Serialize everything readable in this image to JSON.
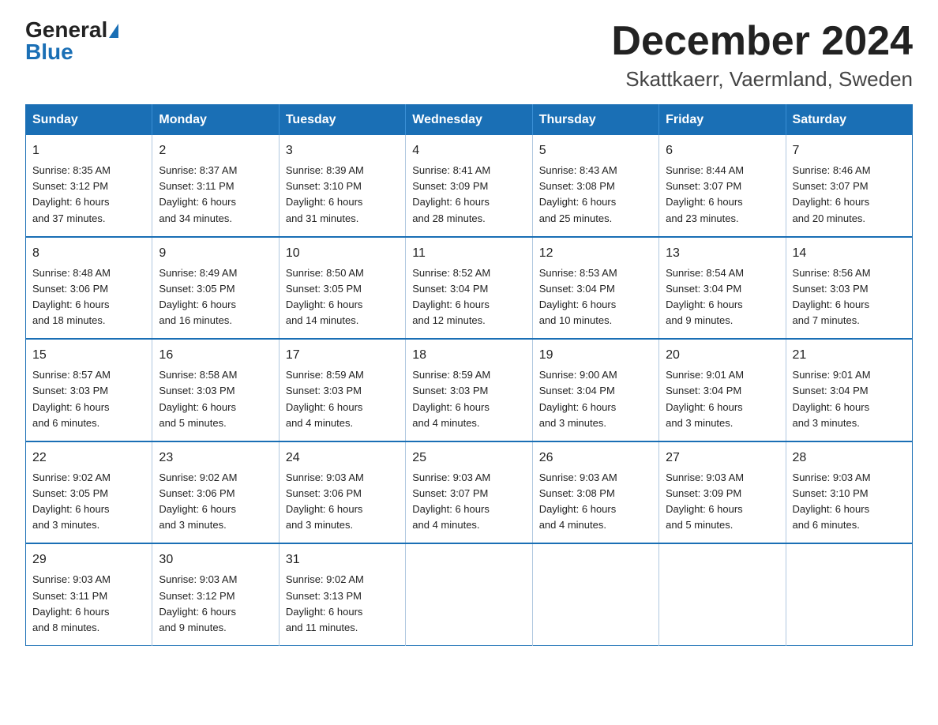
{
  "logo": {
    "general": "General",
    "blue": "Blue"
  },
  "title": {
    "main": "December 2024",
    "sub": "Skattkaerr, Vaermland, Sweden"
  },
  "days_of_week": [
    "Sunday",
    "Monday",
    "Tuesday",
    "Wednesday",
    "Thursday",
    "Friday",
    "Saturday"
  ],
  "weeks": [
    [
      {
        "day": "1",
        "info": "Sunrise: 8:35 AM\nSunset: 3:12 PM\nDaylight: 6 hours\nand 37 minutes."
      },
      {
        "day": "2",
        "info": "Sunrise: 8:37 AM\nSunset: 3:11 PM\nDaylight: 6 hours\nand 34 minutes."
      },
      {
        "day": "3",
        "info": "Sunrise: 8:39 AM\nSunset: 3:10 PM\nDaylight: 6 hours\nand 31 minutes."
      },
      {
        "day": "4",
        "info": "Sunrise: 8:41 AM\nSunset: 3:09 PM\nDaylight: 6 hours\nand 28 minutes."
      },
      {
        "day": "5",
        "info": "Sunrise: 8:43 AM\nSunset: 3:08 PM\nDaylight: 6 hours\nand 25 minutes."
      },
      {
        "day": "6",
        "info": "Sunrise: 8:44 AM\nSunset: 3:07 PM\nDaylight: 6 hours\nand 23 minutes."
      },
      {
        "day": "7",
        "info": "Sunrise: 8:46 AM\nSunset: 3:07 PM\nDaylight: 6 hours\nand 20 minutes."
      }
    ],
    [
      {
        "day": "8",
        "info": "Sunrise: 8:48 AM\nSunset: 3:06 PM\nDaylight: 6 hours\nand 18 minutes."
      },
      {
        "day": "9",
        "info": "Sunrise: 8:49 AM\nSunset: 3:05 PM\nDaylight: 6 hours\nand 16 minutes."
      },
      {
        "day": "10",
        "info": "Sunrise: 8:50 AM\nSunset: 3:05 PM\nDaylight: 6 hours\nand 14 minutes."
      },
      {
        "day": "11",
        "info": "Sunrise: 8:52 AM\nSunset: 3:04 PM\nDaylight: 6 hours\nand 12 minutes."
      },
      {
        "day": "12",
        "info": "Sunrise: 8:53 AM\nSunset: 3:04 PM\nDaylight: 6 hours\nand 10 minutes."
      },
      {
        "day": "13",
        "info": "Sunrise: 8:54 AM\nSunset: 3:04 PM\nDaylight: 6 hours\nand 9 minutes."
      },
      {
        "day": "14",
        "info": "Sunrise: 8:56 AM\nSunset: 3:03 PM\nDaylight: 6 hours\nand 7 minutes."
      }
    ],
    [
      {
        "day": "15",
        "info": "Sunrise: 8:57 AM\nSunset: 3:03 PM\nDaylight: 6 hours\nand 6 minutes."
      },
      {
        "day": "16",
        "info": "Sunrise: 8:58 AM\nSunset: 3:03 PM\nDaylight: 6 hours\nand 5 minutes."
      },
      {
        "day": "17",
        "info": "Sunrise: 8:59 AM\nSunset: 3:03 PM\nDaylight: 6 hours\nand 4 minutes."
      },
      {
        "day": "18",
        "info": "Sunrise: 8:59 AM\nSunset: 3:03 PM\nDaylight: 6 hours\nand 4 minutes."
      },
      {
        "day": "19",
        "info": "Sunrise: 9:00 AM\nSunset: 3:04 PM\nDaylight: 6 hours\nand 3 minutes."
      },
      {
        "day": "20",
        "info": "Sunrise: 9:01 AM\nSunset: 3:04 PM\nDaylight: 6 hours\nand 3 minutes."
      },
      {
        "day": "21",
        "info": "Sunrise: 9:01 AM\nSunset: 3:04 PM\nDaylight: 6 hours\nand 3 minutes."
      }
    ],
    [
      {
        "day": "22",
        "info": "Sunrise: 9:02 AM\nSunset: 3:05 PM\nDaylight: 6 hours\nand 3 minutes."
      },
      {
        "day": "23",
        "info": "Sunrise: 9:02 AM\nSunset: 3:06 PM\nDaylight: 6 hours\nand 3 minutes."
      },
      {
        "day": "24",
        "info": "Sunrise: 9:03 AM\nSunset: 3:06 PM\nDaylight: 6 hours\nand 3 minutes."
      },
      {
        "day": "25",
        "info": "Sunrise: 9:03 AM\nSunset: 3:07 PM\nDaylight: 6 hours\nand 4 minutes."
      },
      {
        "day": "26",
        "info": "Sunrise: 9:03 AM\nSunset: 3:08 PM\nDaylight: 6 hours\nand 4 minutes."
      },
      {
        "day": "27",
        "info": "Sunrise: 9:03 AM\nSunset: 3:09 PM\nDaylight: 6 hours\nand 5 minutes."
      },
      {
        "day": "28",
        "info": "Sunrise: 9:03 AM\nSunset: 3:10 PM\nDaylight: 6 hours\nand 6 minutes."
      }
    ],
    [
      {
        "day": "29",
        "info": "Sunrise: 9:03 AM\nSunset: 3:11 PM\nDaylight: 6 hours\nand 8 minutes."
      },
      {
        "day": "30",
        "info": "Sunrise: 9:03 AM\nSunset: 3:12 PM\nDaylight: 6 hours\nand 9 minutes."
      },
      {
        "day": "31",
        "info": "Sunrise: 9:02 AM\nSunset: 3:13 PM\nDaylight: 6 hours\nand 11 minutes."
      },
      null,
      null,
      null,
      null
    ]
  ]
}
